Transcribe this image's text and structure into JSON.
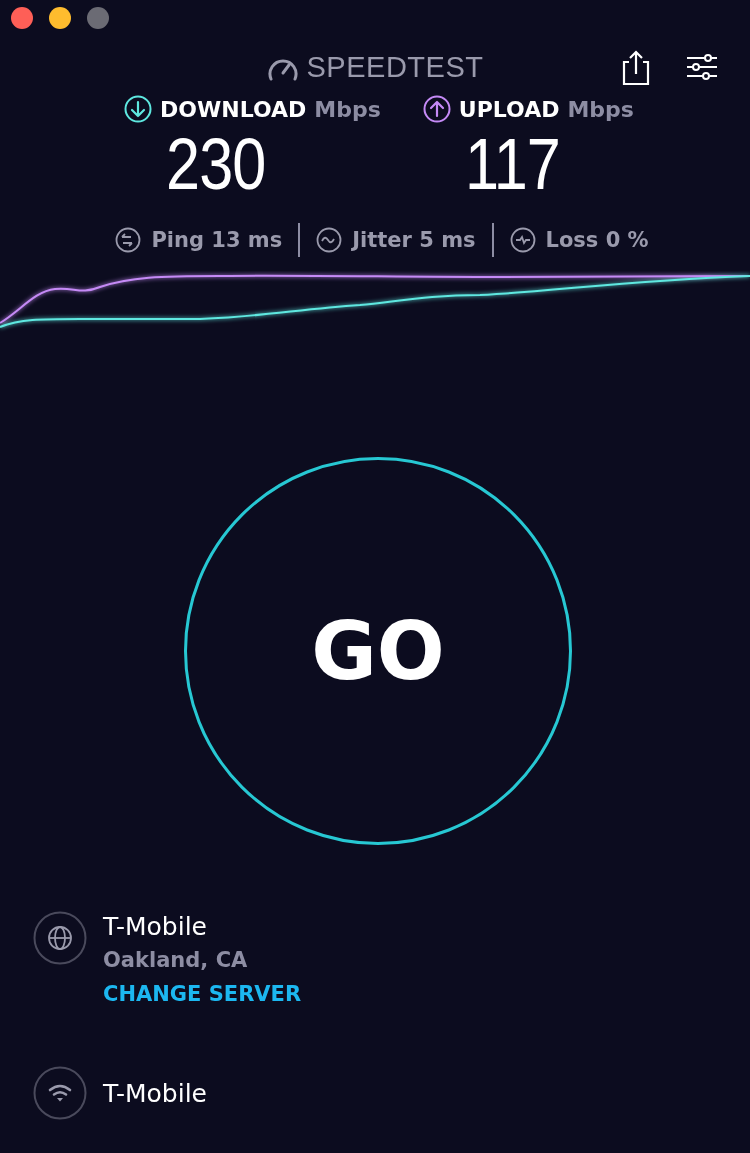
{
  "window": {
    "controls": [
      {
        "color": "#fe5f57"
      },
      {
        "color": "#febc2e"
      },
      {
        "color": "#6b6b74"
      }
    ]
  },
  "header": {
    "title": "SPEEDTEST"
  },
  "metrics": [
    {
      "kind": "download",
      "label": "DOWNLOAD",
      "unit": "Mbps",
      "value": "230",
      "color": "#5ee8e0"
    },
    {
      "kind": "upload",
      "label": "UPLOAD",
      "unit": "Mbps",
      "value": "117",
      "color": "#c58af6"
    }
  ],
  "stats": [
    {
      "kind": "ping",
      "text": "Ping 13 ms"
    },
    {
      "kind": "jitter",
      "text": "Jitter 5 ms"
    },
    {
      "kind": "loss",
      "text": "Loss 0 %"
    }
  ],
  "go_button": {
    "label": "GO"
  },
  "server": {
    "provider": "T-Mobile",
    "location": "Oakland, CA",
    "action": "CHANGE SERVER"
  },
  "network": {
    "name": "T-Mobile"
  }
}
